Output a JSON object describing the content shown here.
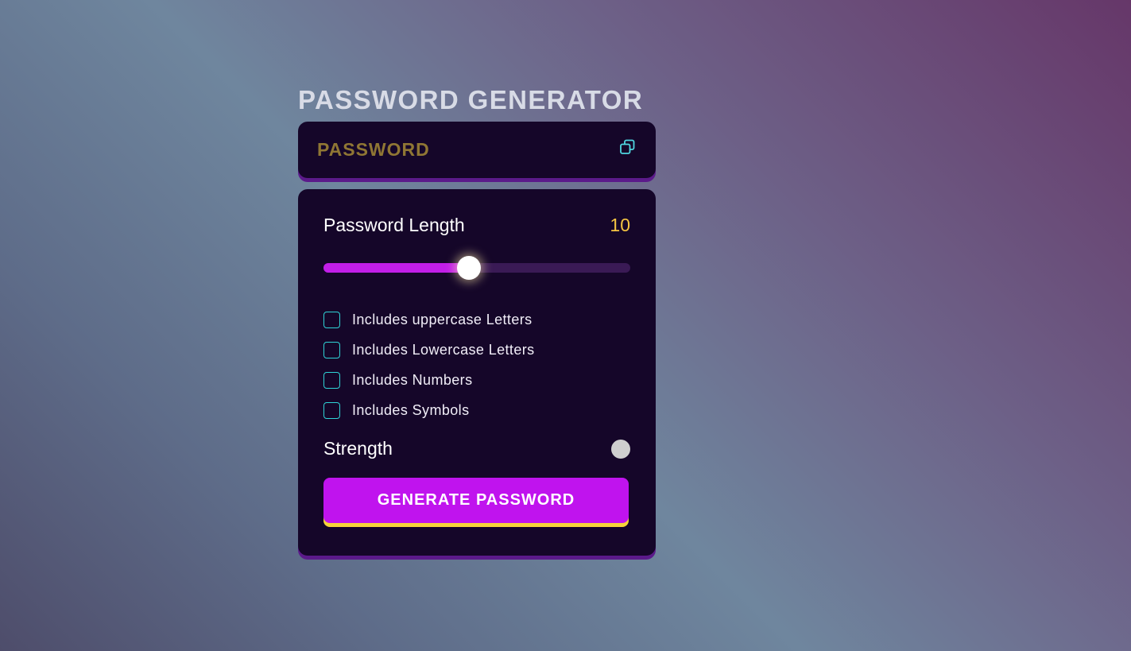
{
  "app": {
    "title": "PASSWORD GENERATOR"
  },
  "display": {
    "placeholder": "PASSWORD",
    "copy_icon": "copy-icon"
  },
  "length": {
    "label": "Password Length",
    "value": "10",
    "slider_fraction": 0.475
  },
  "options": [
    {
      "label": "Includes uppercase Letters",
      "checked": false
    },
    {
      "label": "Includes Lowercase Letters",
      "checked": false
    },
    {
      "label": "Includes Numbers",
      "checked": false
    },
    {
      "label": "Includes Symbols",
      "checked": false
    }
  ],
  "strength": {
    "label": "Strength",
    "indicator_color": "#cfcfcf"
  },
  "generate_button": {
    "label": "GENERATE PASSWORD"
  },
  "colors": {
    "card": "#150629",
    "accent": "#c013ee",
    "highlight": "#f5c542",
    "checkbox": "#2fd3d6"
  }
}
